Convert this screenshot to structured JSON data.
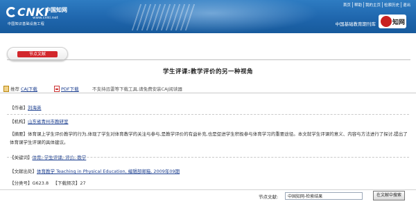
{
  "header": {
    "logo_text": "CNKI",
    "logo_cn": "中国知网",
    "logo_url": "www.cnki.net",
    "logo_tagline": "中国知识基础设施工程",
    "right_title": "中国基础教育期刊库",
    "right_logo_text": "知网",
    "top_links": [
      "首页",
      "帮助",
      "我的主页",
      "检索历史",
      "退出"
    ]
  },
  "section_badge": "节点文献",
  "article": {
    "title": "学生评课:教学评价的另一种视角"
  },
  "toolbar": {
    "caj_label": "CAJ下载",
    "caj_prefix": "推荐",
    "pdf_label": "PDF下载",
    "extra_text": "不支持迅雷等下载工具,请免费安装CAJ阅读器"
  },
  "fields": {
    "author_label": "【作者】",
    "author_value": "刘海英",
    "org_label": "【机构】",
    "org_value": "山东省青州市教研室",
    "abstract_label": "【摘要】",
    "abstract_value": "体育课上学生评价教学的行为,体现了学生对体育教学的关注与参与,是教学评价的有益补充,也是促进学生积极参与体育学习的重要途径。本文就学生评课的意义、内容与方法进行了探讨,提出了体育课学生评课的具体建议。",
    "keywords_label": "【关键词】",
    "keywords_value": "体育; 学生评课; 评价; 教学",
    "source_label": "【文献出处】",
    "source_value": "体育教学 Teaching in Physical Education, 编辑部邮箱, 2009年09期",
    "class_label": "【分类号】",
    "class_value": "G623.8",
    "downloads_label": "【下载频次】",
    "downloads_value": "27"
  },
  "search": {
    "label": "节点文献:",
    "value": "中国知网-检索结果",
    "button": "在文献中搜索"
  }
}
